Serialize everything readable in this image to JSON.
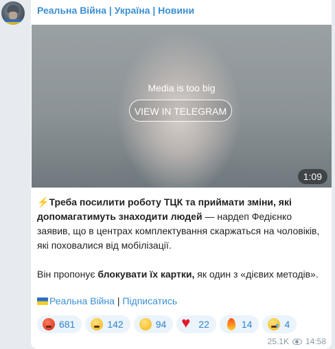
{
  "channel": {
    "title": "Реальна Війна | Україна | Новини"
  },
  "media": {
    "notice": "Media is too big",
    "button_label": "VIEW IN TELEGRAM",
    "duration": "1:09"
  },
  "post": {
    "bolt": "⚡️",
    "bold_intro": "Треба посилити роботу ТЦК та приймати зміни, які допомагатимуть знаходити людей",
    "rest_intro": " — нардеп Федієнко заявив, що в центрах комплектування скаржаться на чоловіків, які поховалися від мобілізації.",
    "p2_start": "Він пропонує ",
    "p2_bold": "блокувати їх картки,",
    "p2_end": " як один з «дієвих методів».",
    "signature_link": "Реальна Війна",
    "separator": " | ",
    "subscribe_link": "Підписатись"
  },
  "reactions": [
    {
      "emoji": "angry-face",
      "count": "681"
    },
    {
      "emoji": "grinning-face",
      "count": "142"
    },
    {
      "emoji": "thumbs-up",
      "count": "94"
    },
    {
      "emoji": "red-heart",
      "count": "22"
    },
    {
      "emoji": "fire",
      "count": "14"
    },
    {
      "emoji": "crying-face",
      "count": "4"
    }
  ],
  "meta": {
    "views": "25.1K",
    "time": "14:58"
  },
  "colors": {
    "link": "#3a8fd3",
    "background": "#e7ebf0",
    "reaction_bg": "#ebf3fb"
  }
}
